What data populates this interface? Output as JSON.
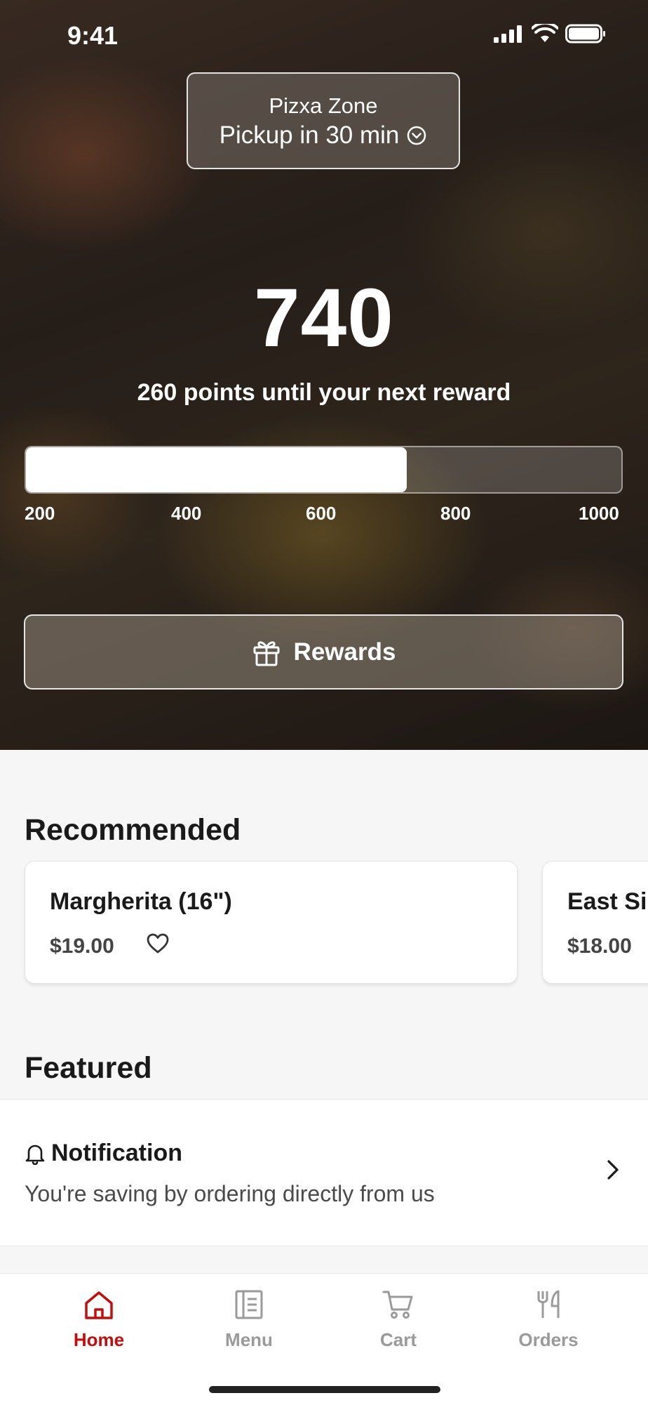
{
  "status_bar": {
    "time": "9:41"
  },
  "store": {
    "name": "Pizxa Zone",
    "pickup_label": "Pickup in 30 min"
  },
  "rewards": {
    "points": "740",
    "points_until_label": "260 points until your next reward",
    "progress_fraction": 0.64,
    "ticks": [
      "200",
      "400",
      "600",
      "800",
      "1000"
    ],
    "button_label": "Rewards"
  },
  "recommended": {
    "title": "Recommended",
    "items": [
      {
        "name": "Margherita (16\")",
        "price": "$19.00"
      },
      {
        "name": "East Si",
        "price": "$18.00"
      }
    ]
  },
  "featured": {
    "title": "Featured",
    "notification": {
      "title": "Notification",
      "body": "You're saving by ordering directly from us"
    }
  },
  "tabs": [
    {
      "label": "Home",
      "icon": "home-icon",
      "active": true
    },
    {
      "label": "Menu",
      "icon": "menu-icon",
      "active": false
    },
    {
      "label": "Cart",
      "icon": "cart-icon",
      "active": false
    },
    {
      "label": "Orders",
      "icon": "orders-icon",
      "active": false
    }
  ],
  "colors": {
    "accent": "#c40e0e",
    "inactive_tab": "#9a9a9a"
  }
}
